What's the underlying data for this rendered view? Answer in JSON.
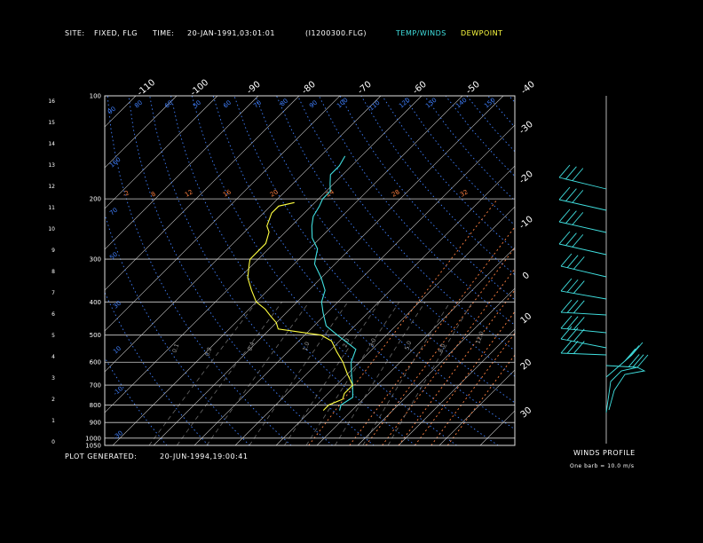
{
  "header": {
    "site_label": "SITE:",
    "site_value": "FIXED, FLG",
    "time_label": "TIME:",
    "time_value": "20-JAN-1991,03:01:01",
    "file_value": "(I1200300.FLG)",
    "legend_temp": "TEMP/WINDS",
    "legend_dew": "DEWPOINT"
  },
  "footer": {
    "plot_generated_label": "PLOT GENERATED:",
    "plot_generated_value": "20-JUN-1994,19:00:41",
    "winds_title": "WINDS PROFILE",
    "winds_note": "One barb = 10.0 m/s"
  },
  "colors": {
    "temp": "#40e0e0",
    "dew": "#ffff40",
    "isotherm": "#c8c8c8",
    "dry_adiabat": "#4080ff",
    "moist_adiabat": "#ff8040",
    "mixing_ratio": "#6a6a6a"
  },
  "chart_data": {
    "type": "line",
    "skew_t_log_p": true,
    "pressure_ticks": [
      100,
      200,
      300,
      400,
      500,
      600,
      700,
      800,
      900,
      1000,
      1050
    ],
    "height_ticks": [
      "16",
      "15",
      "14",
      "13",
      "12",
      "11",
      "10",
      "9",
      "8",
      "7",
      "6",
      "5",
      "4",
      "3",
      "2",
      "1",
      "0"
    ],
    "temperature_ticks_top": [
      "-110",
      "-100",
      "-90",
      "-80",
      "-70",
      "-60",
      "-50",
      "-40"
    ],
    "temperature_ticks_right": [
      "-30",
      "-20",
      "-10",
      "0",
      "10",
      "20",
      "30"
    ],
    "dry_adiabat_labels": [
      "90",
      "80",
      "60",
      "50",
      "60",
      "70",
      "80",
      "90",
      "100",
      "110",
      "120",
      "130",
      "140",
      "150",
      "160",
      "70",
      "50",
      "30",
      "10",
      "-10",
      "-30"
    ],
    "moist_adiabat_labels": [
      "-2",
      "8",
      "12",
      "16",
      "20",
      "24",
      "28",
      "32"
    ],
    "mixing_ratio_labels": [
      "0.1",
      "0.2",
      "0.4",
      "1.0",
      "2.0",
      "3.0",
      "5.0",
      "8.0",
      "12.0"
    ],
    "series": [
      {
        "name": "TEMP/WINDS",
        "points": [
          [
            830,
            -3
          ],
          [
            800,
            -4
          ],
          [
            760,
            -3
          ],
          [
            700,
            -6
          ],
          [
            650,
            -9
          ],
          [
            600,
            -12
          ],
          [
            550,
            -14
          ],
          [
            500,
            -22
          ],
          [
            470,
            -27
          ],
          [
            430,
            -31
          ],
          [
            400,
            -34
          ],
          [
            370,
            -36
          ],
          [
            340,
            -40
          ],
          [
            310,
            -45
          ],
          [
            300,
            -46
          ],
          [
            280,
            -48
          ],
          [
            260,
            -52
          ],
          [
            240,
            -55
          ],
          [
            225,
            -57
          ],
          [
            210,
            -58
          ],
          [
            200,
            -59
          ],
          [
            190,
            -59
          ],
          [
            180,
            -61
          ],
          [
            170,
            -63
          ],
          [
            160,
            -63
          ],
          [
            150,
            -64
          ]
        ]
      },
      {
        "name": "DEWPOINT",
        "points": [
          [
            830,
            -7
          ],
          [
            800,
            -7
          ],
          [
            770,
            -5
          ],
          [
            740,
            -6
          ],
          [
            700,
            -6
          ],
          [
            650,
            -10
          ],
          [
            600,
            -14
          ],
          [
            560,
            -18
          ],
          [
            520,
            -22
          ],
          [
            500,
            -26
          ],
          [
            480,
            -38
          ],
          [
            460,
            -40
          ],
          [
            440,
            -43
          ],
          [
            420,
            -46
          ],
          [
            400,
            -50
          ],
          [
            370,
            -54
          ],
          [
            340,
            -58
          ],
          [
            310,
            -61
          ],
          [
            300,
            -62
          ],
          [
            270,
            -62
          ],
          [
            250,
            -64
          ],
          [
            240,
            -66
          ],
          [
            220,
            -68
          ],
          [
            210,
            -68
          ],
          [
            205,
            -65
          ]
        ]
      }
    ]
  }
}
